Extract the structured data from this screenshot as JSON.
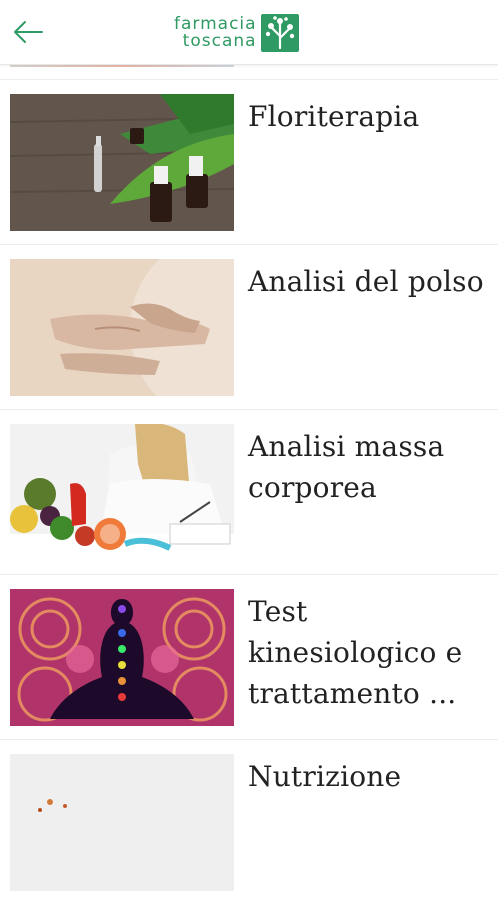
{
  "header": {
    "back_label": "back",
    "logo_line1": "farmacia",
    "logo_line2": "toscana",
    "brand_color": "#2f9a63"
  },
  "items": [
    {
      "title": "Floriterapia"
    },
    {
      "title": "Analisi del polso"
    },
    {
      "title": "Analisi massa corporea"
    },
    {
      "title": "Test kinesiologico e trattamento ..."
    },
    {
      "title": "Nutrizione"
    }
  ]
}
